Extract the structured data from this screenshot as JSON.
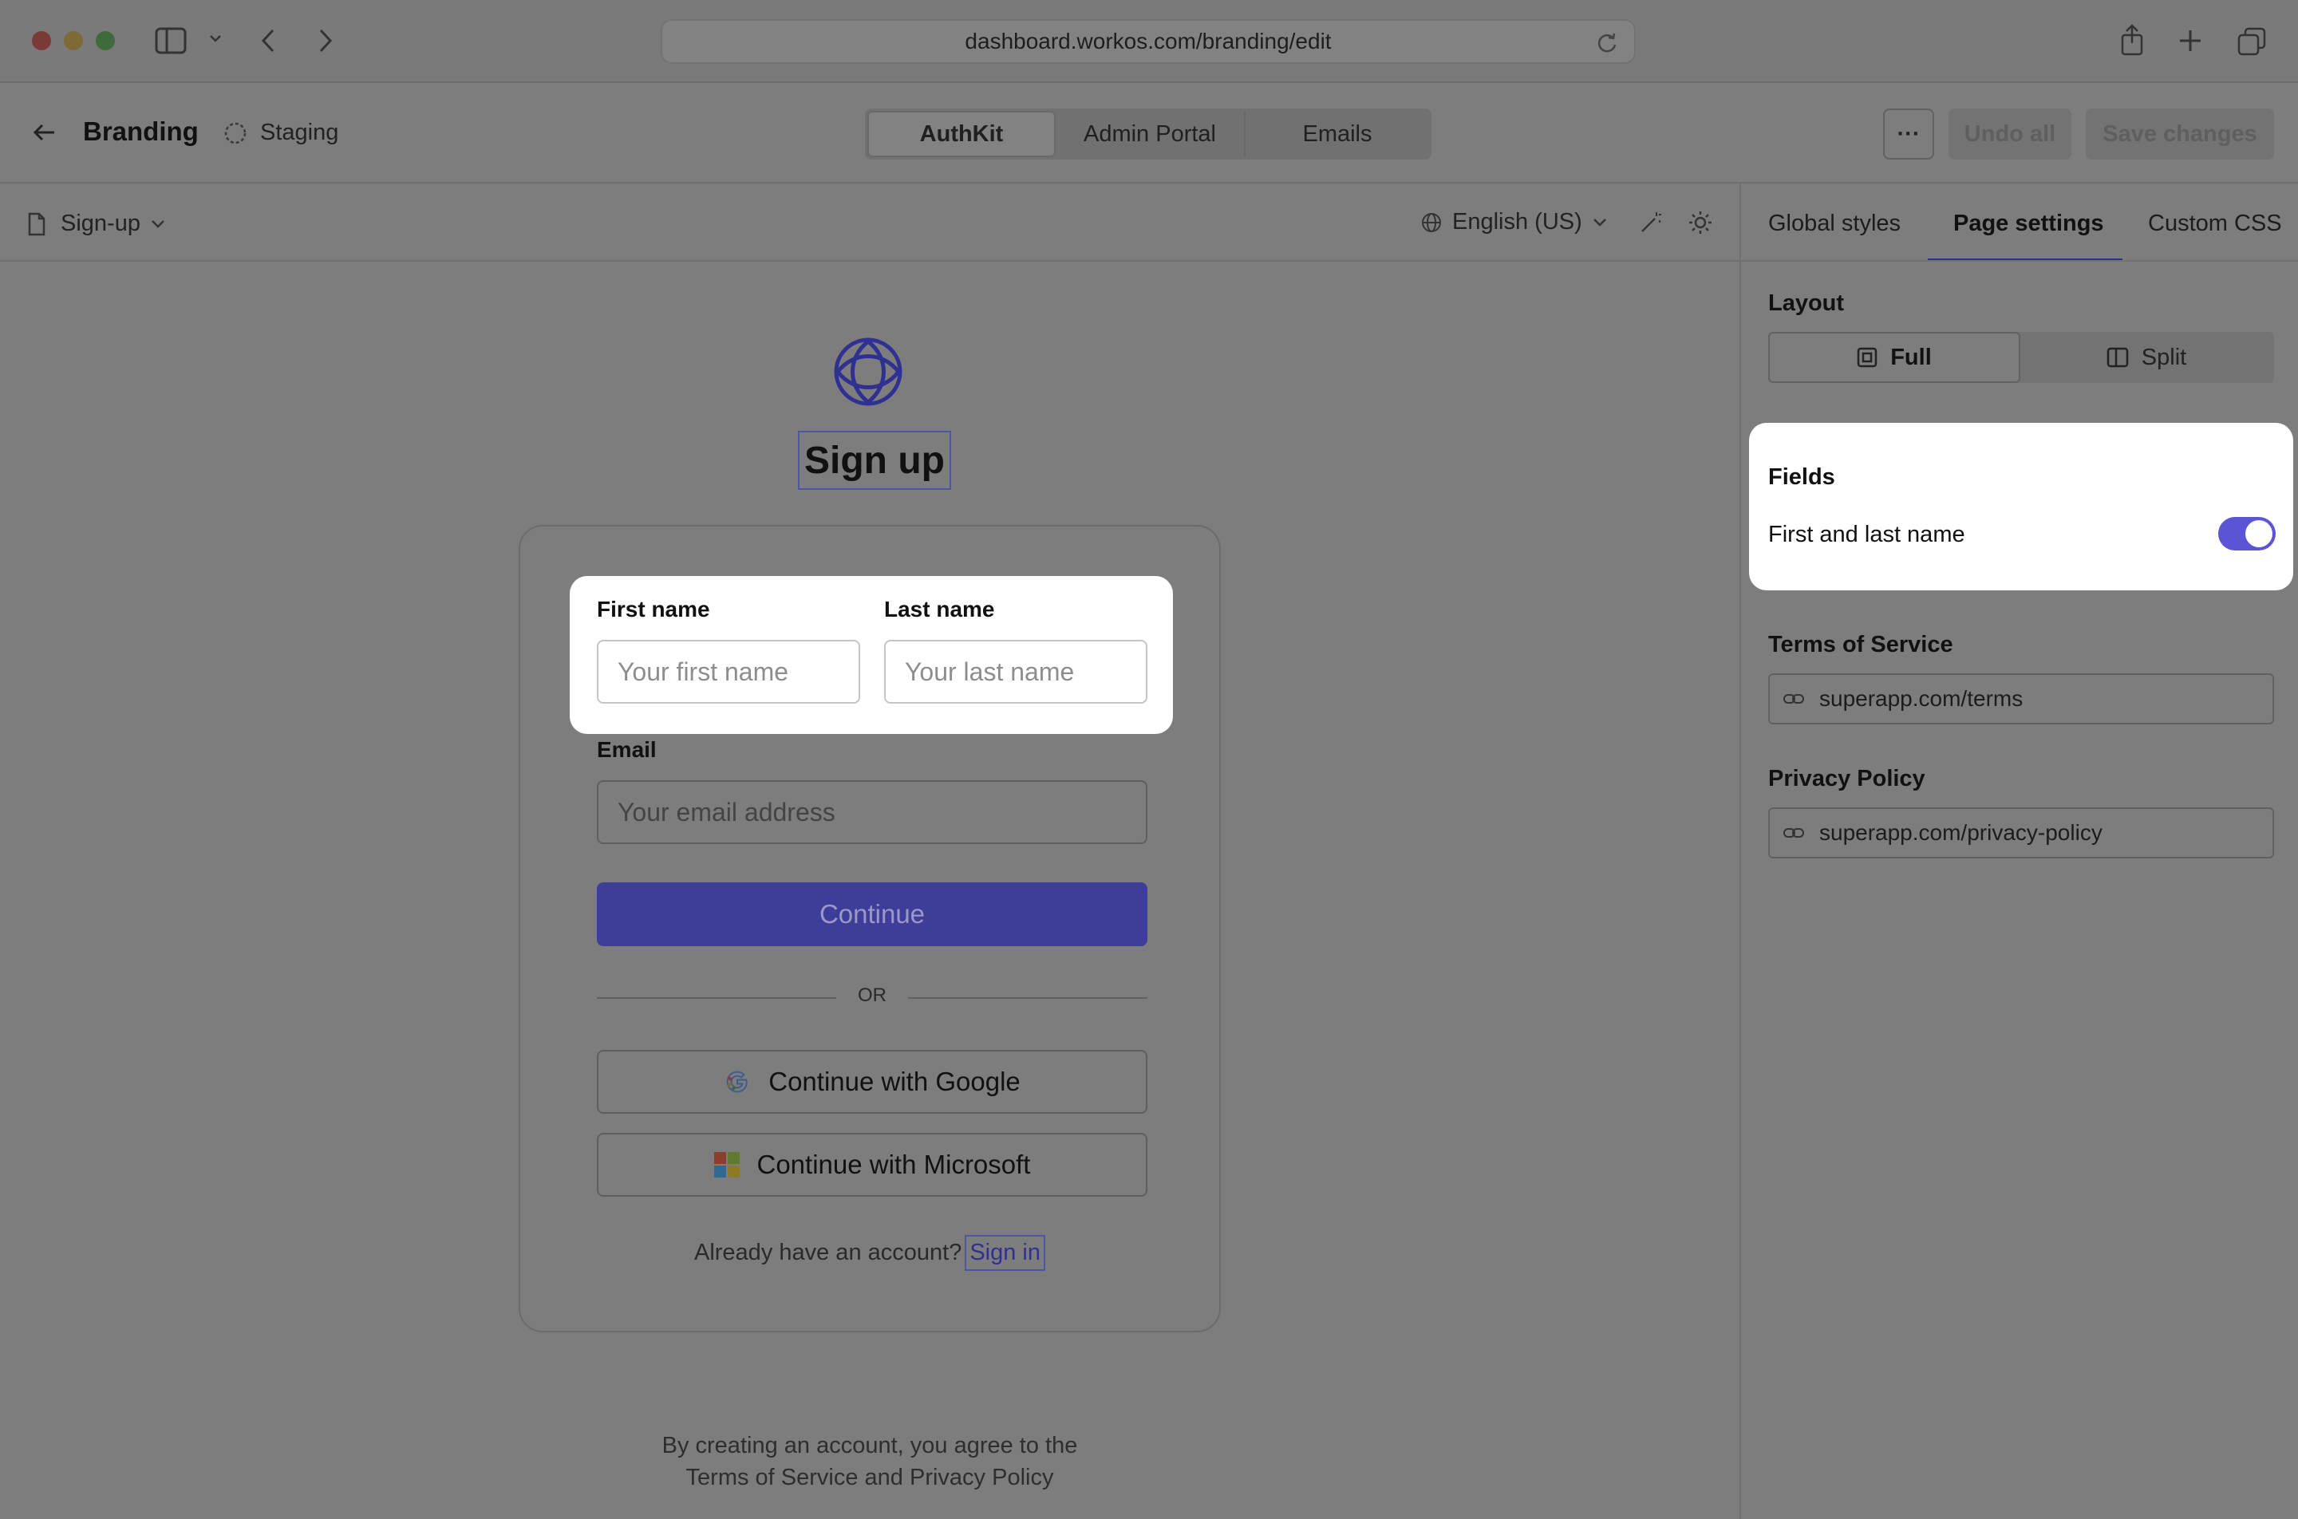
{
  "browser": {
    "url": "dashboard.workos.com/branding/edit"
  },
  "header": {
    "title": "Branding",
    "environment": "Staging",
    "tabs": [
      {
        "label": "AuthKit",
        "active": true
      },
      {
        "label": "Admin Portal",
        "active": false
      },
      {
        "label": "Emails",
        "active": false
      }
    ],
    "more_label": "···",
    "undo_label": "Undo all",
    "save_label": "Save changes"
  },
  "toolbar": {
    "page_select": "Sign-up",
    "language": "English (US)"
  },
  "preview": {
    "heading": "Sign up",
    "first_name_label": "First name",
    "first_name_placeholder": "Your first name",
    "last_name_label": "Last name",
    "last_name_placeholder": "Your last name",
    "email_label": "Email",
    "email_placeholder": "Your email address",
    "continue_label": "Continue",
    "divider_text": "OR",
    "google_label": "Continue with Google",
    "microsoft_label": "Continue with Microsoft",
    "account_prompt": "Already have an account?",
    "sign_in_label": "Sign in",
    "legal_line1": "By creating an account, you agree to the",
    "legal_line2": "Terms of Service and Privacy Policy",
    "accent_color": "#3f3d9a"
  },
  "panel": {
    "tabs": [
      {
        "label": "Global styles",
        "active": false
      },
      {
        "label": "Page settings",
        "active": true
      },
      {
        "label": "Custom CSS",
        "active": false
      }
    ],
    "layout_title": "Layout",
    "layout_full": "Full",
    "layout_split": "Split",
    "layout_selected": "Full",
    "fields_title": "Fields",
    "first_last_name_label": "First and last name",
    "first_last_name_enabled": true,
    "tos_title": "Terms of Service",
    "tos_value": "superapp.com/terms",
    "privacy_title": "Privacy Policy",
    "privacy_value": "superapp.com/privacy-policy",
    "toggle_color": "#5b55d6"
  }
}
